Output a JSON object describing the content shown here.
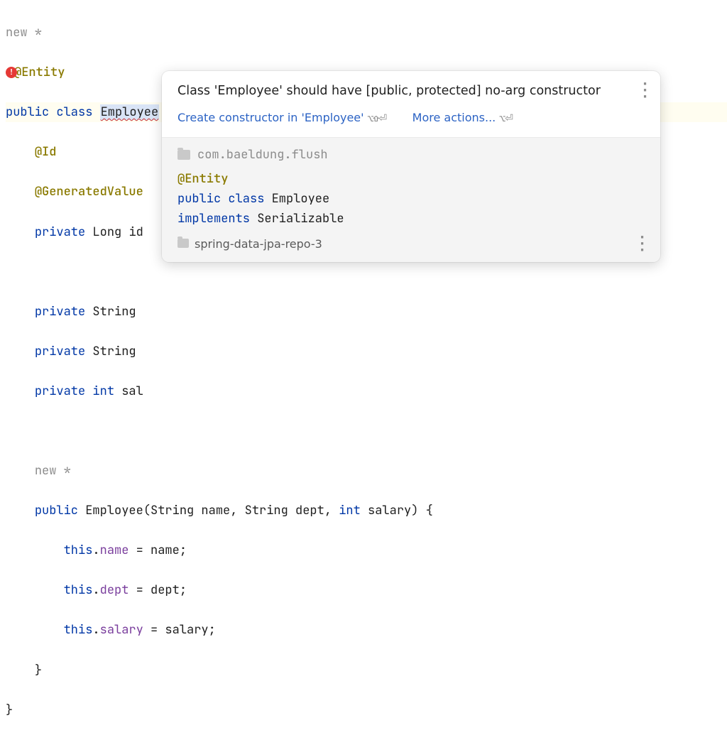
{
  "editor": {
    "new_label": "new *",
    "ann_entity": "@Entity",
    "kw_public": "public",
    "kw_class": "class",
    "class_name": "Employee",
    "kw_implements": "implements",
    "iface": "Serializable",
    "open_brace": " {",
    "ann_id": "@Id",
    "ann_gen": "@GeneratedValue",
    "kw_private": "private",
    "type_long": "Long",
    "fld_id": "id",
    "type_string": "String",
    "kw_int": "int",
    "fld_sal_fragment": "sal",
    "ctor_new": "new *",
    "ctor_sig_1": "Employee(String name, String dept, ",
    "ctor_sig_2": " salary) {",
    "stmt_name_lhs": "this",
    "stmt_name_field": "name",
    "stmt_name_rhs": " = name;",
    "stmt_dept_field": "dept",
    "stmt_dept_rhs": " = dept;",
    "stmt_sal_field": "salary",
    "stmt_sal_rhs": " = salary;",
    "close_inner": "}",
    "close_outer": "}"
  },
  "popup": {
    "title": "Class 'Employee' should have [public, protected] no-arg constructor",
    "action_create": "Create constructor in 'Employee'",
    "shortcut_create": "⌥⇧⏎",
    "action_more": "More actions...",
    "shortcut_more": "⌥⏎",
    "package": "com.baeldung.flush",
    "preview_ann": "@Entity",
    "preview_l1_kw1": "public",
    "preview_l1_kw2": "class",
    "preview_l1_name": "Employee",
    "preview_l2_kw": "implements",
    "preview_l2_iface": "Serializable",
    "module": "spring-data-jpa-repo-3"
  }
}
